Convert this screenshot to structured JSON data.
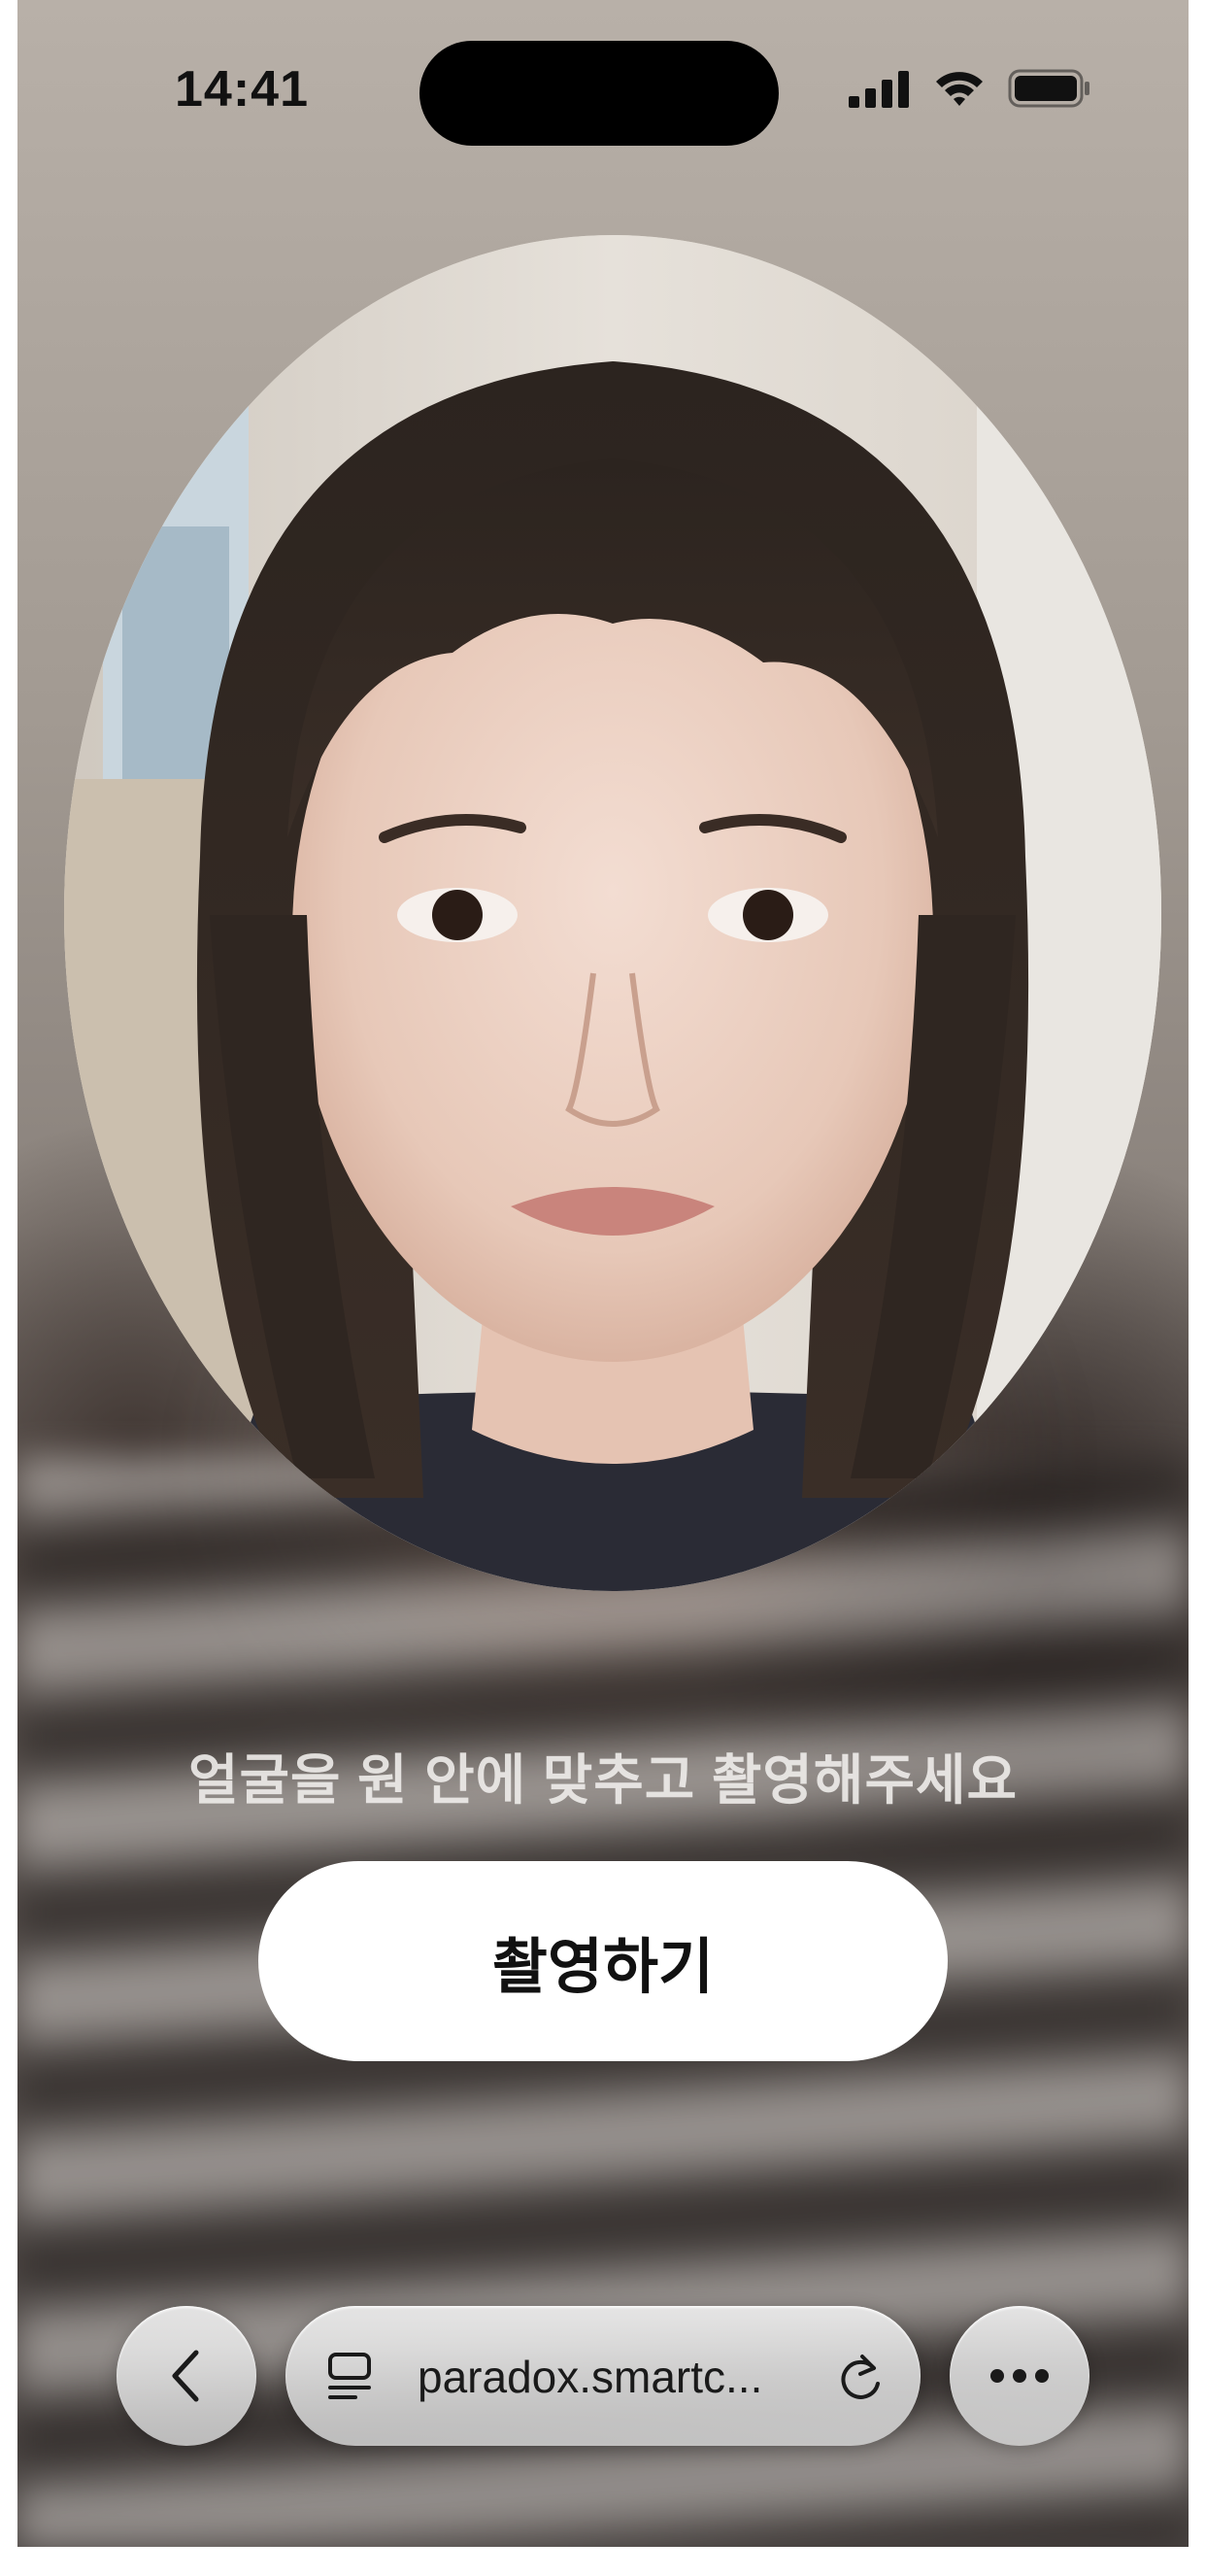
{
  "status_bar": {
    "time": "14:41",
    "icons": [
      "cellular-signal-icon",
      "wifi-icon",
      "battery-icon"
    ]
  },
  "camera": {
    "prompt": "얼굴을 원 안에 맞추고 촬영해주세요",
    "capture_label": "촬영하기"
  },
  "browser_toolbar": {
    "url": "paradox.smartc...",
    "icons": [
      "chevron-left-icon",
      "reader-icon",
      "reload-icon",
      "more-icon"
    ]
  },
  "colors": {
    "button_bg": "#ffffff",
    "button_text": "#111111",
    "prompt_text": "#eeecea"
  }
}
